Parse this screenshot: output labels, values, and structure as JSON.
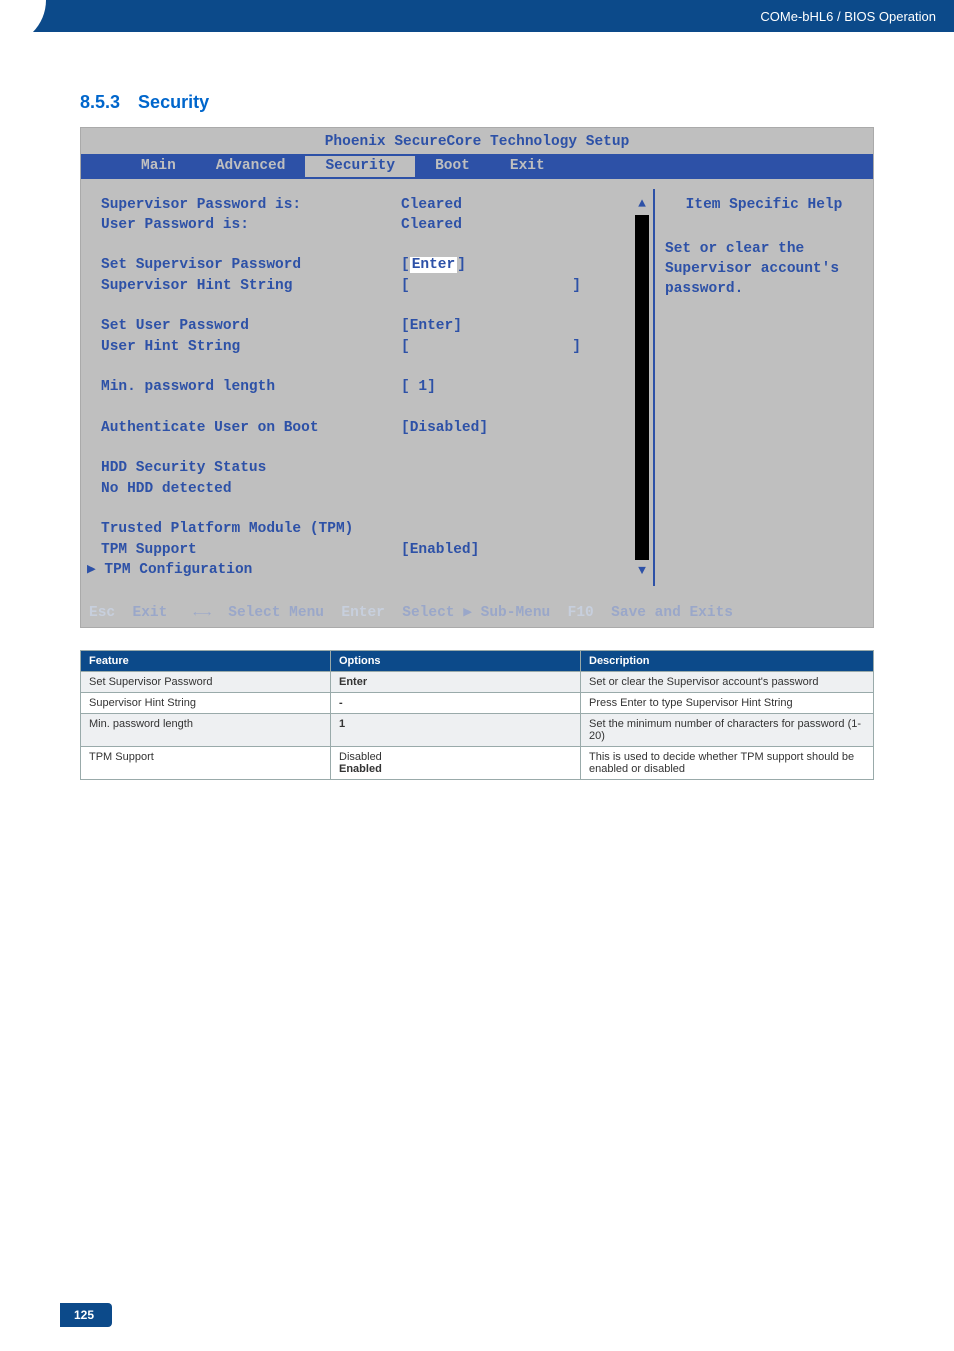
{
  "header": {
    "breadcrumb": "COMe-bHL6 / BIOS Operation"
  },
  "section": {
    "number": "8.5.3",
    "title": "Security"
  },
  "bios": {
    "title": "Phoenix SecureCore Technology Setup",
    "tabs": [
      "Main",
      "Advanced",
      "Security",
      "Boot",
      "Exit"
    ],
    "active_tab": "Security",
    "help_title": "Item Specific Help",
    "help_text": [
      "Set or clear the",
      "Supervisor account's",
      "password."
    ],
    "rows": [
      {
        "label": "Supervisor Password is:",
        "value": "Cleared",
        "bold": true
      },
      {
        "label": "User Password is:",
        "value": "Cleared",
        "bold": true
      },
      {
        "spacer": true
      },
      {
        "label": "Set Supervisor Password",
        "value_prefix": "[",
        "value_highlight": "Enter",
        "value_suffix": "]"
      },
      {
        "label": "Supervisor Hint String",
        "value": "[",
        "value_right": "]"
      },
      {
        "spacer": true
      },
      {
        "label": "Set User Password",
        "value": "[Enter]",
        "bold": true
      },
      {
        "label": "User Hint String",
        "value": "[",
        "value_right": "]",
        "bold": true
      },
      {
        "spacer": true
      },
      {
        "label": "Min. password length",
        "value": "[ 1]"
      },
      {
        "spacer": true
      },
      {
        "label": "Authenticate User on Boot",
        "value": "[Disabled]",
        "bold": true
      },
      {
        "spacer": true
      },
      {
        "label": "HDD Security Status"
      },
      {
        "label": "No HDD detected"
      },
      {
        "spacer": true
      },
      {
        "label": "Trusted Platform Module (TPM)"
      },
      {
        "label": "TPM Support",
        "value": "[Enabled]"
      },
      {
        "label": "▶ TPM Configuration",
        "outdent": true
      }
    ],
    "footer": {
      "esc": "Esc",
      "exit": "Exit",
      "arrows": "←→",
      "select_menu": "Select Menu",
      "enter": "Enter",
      "select_sub": "Select ▶ Sub-Menu",
      "f10": "F10",
      "save": "Save and Exits"
    }
  },
  "table": {
    "headers": [
      "Feature",
      "Options",
      "Description"
    ],
    "rows": [
      {
        "feature": "Set Supervisor Password",
        "options": "Enter",
        "options_bold": true,
        "desc": "Set or clear the Supervisor account's password",
        "alt": true
      },
      {
        "feature": "Supervisor Hint String",
        "options": "-",
        "options_bold": true,
        "desc": "Press Enter to type Supervisor Hint String"
      },
      {
        "feature": "Min. password length",
        "options": "1",
        "options_bold": true,
        "desc": "Set the minimum number of characters for password (1-20)",
        "alt": true
      },
      {
        "feature": "TPM Support",
        "options_line1": "Disabled",
        "options_line2": "Enabled",
        "options_line2_bold": true,
        "desc": "This is used to decide whether TPM support should be enabled or disabled"
      }
    ]
  },
  "footer": {
    "page": "125"
  }
}
